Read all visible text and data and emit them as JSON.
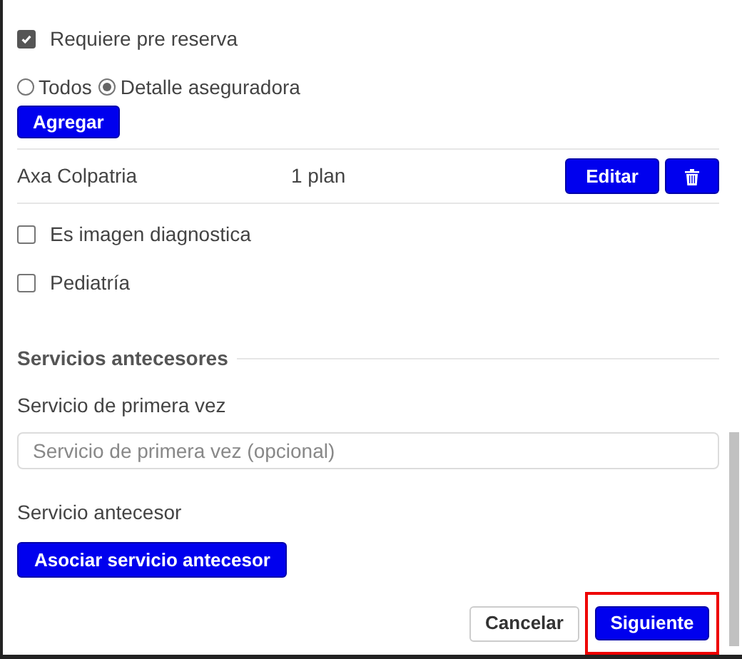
{
  "pre_reserva": {
    "label": "Requiere pre reserva",
    "checked": true
  },
  "scope_options": [
    {
      "label": "Todos",
      "selected": false
    },
    {
      "label": "Detalle aseguradora",
      "selected": true
    }
  ],
  "add_button": "Agregar",
  "insurers": [
    {
      "name": "Axa Colpatria",
      "plans": "1 plan",
      "edit": "Editar"
    }
  ],
  "flags": [
    {
      "label": "Es imagen diagnostica",
      "checked": false
    },
    {
      "label": "Pediatría",
      "checked": false
    }
  ],
  "section": {
    "title": "Servicios antecesores",
    "first_label": "Servicio de primera vez",
    "first_placeholder": "Servicio de primera vez (opcional)",
    "predecessor_label": "Servicio antecesor",
    "associate_button": "Asociar servicio antecesor"
  },
  "footer": {
    "cancel": "Cancelar",
    "next": "Siguiente"
  }
}
